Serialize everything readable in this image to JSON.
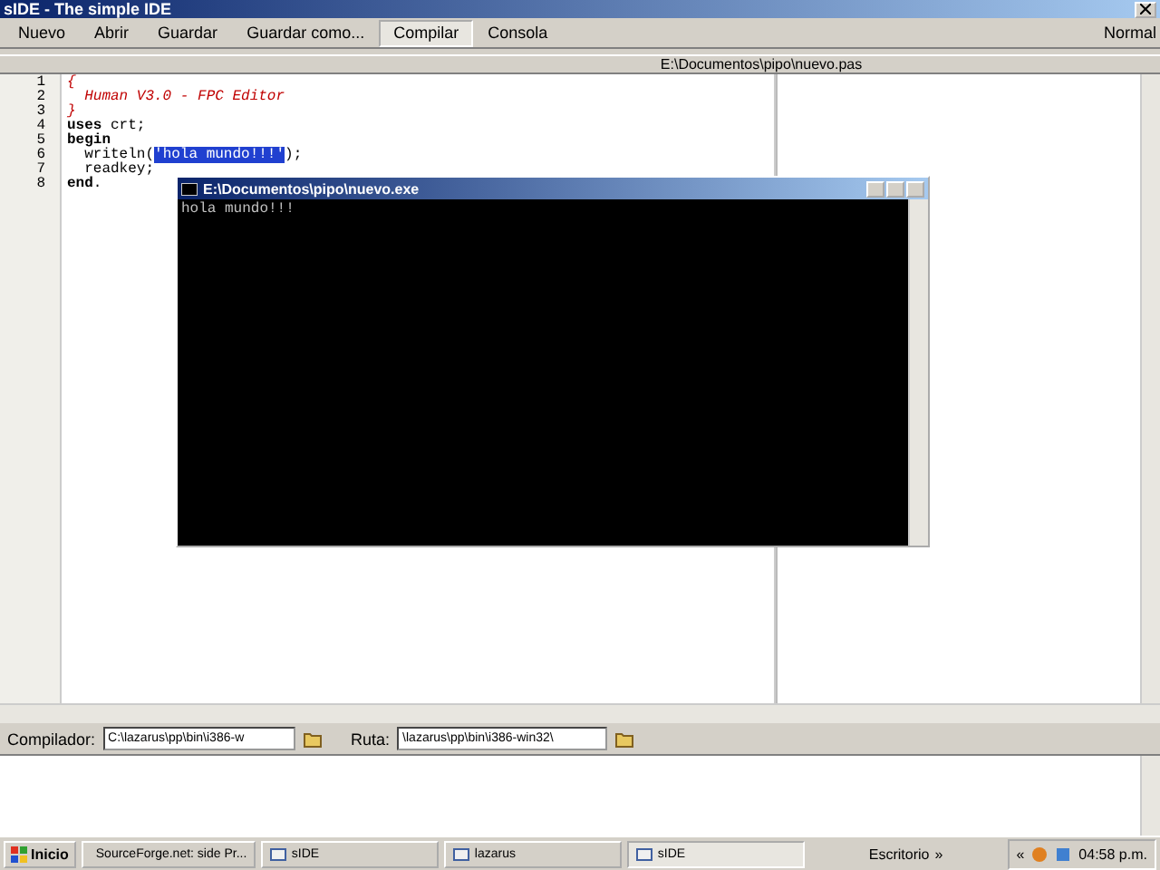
{
  "window": {
    "title": "sIDE - The simple IDE"
  },
  "toolbar": [
    {
      "label": "Nuevo",
      "selected": false
    },
    {
      "label": "Abrir",
      "selected": false
    },
    {
      "label": "Guardar",
      "selected": false
    },
    {
      "label": "Guardar como...",
      "selected": false
    },
    {
      "label": "Compilar",
      "selected": true
    },
    {
      "label": "Consola",
      "selected": false
    }
  ],
  "mode": "Normal",
  "file_path": "E:\\Documentos\\pipo\\nuevo.pas",
  "editor": {
    "lines": [
      {
        "number": "1",
        "segments": [
          {
            "text": "{",
            "kind": "comment"
          }
        ]
      },
      {
        "number": "2",
        "segments": [
          {
            "text": "  Human V3.0 - FPC Editor",
            "kind": "comment"
          }
        ]
      },
      {
        "number": "3",
        "segments": [
          {
            "text": "}",
            "kind": "comment"
          }
        ]
      },
      {
        "number": "4",
        "segments": [
          {
            "text": "uses",
            "kind": "keyword"
          },
          {
            "text": " crt;",
            "kind": "plain"
          }
        ]
      },
      {
        "number": "5",
        "segments": [
          {
            "text": "begin",
            "kind": "keyword"
          }
        ]
      },
      {
        "number": "6",
        "segments": [
          {
            "text": "  writeln(",
            "kind": "plain"
          },
          {
            "text": "'hola mundo!!!'",
            "kind": "selected"
          },
          {
            "text": ");",
            "kind": "plain"
          }
        ]
      },
      {
        "number": "7",
        "segments": [
          {
            "text": "  readkey;",
            "kind": "plain"
          }
        ]
      },
      {
        "number": "8",
        "segments": [
          {
            "text": "end",
            "kind": "keyword"
          },
          {
            "text": ".",
            "kind": "plain"
          }
        ]
      }
    ]
  },
  "console": {
    "title": "E:\\Documentos\\pipo\\nuevo.exe",
    "output": "hola mundo!!!"
  },
  "compiler_bar": {
    "compiler_label": "Compilador:",
    "compiler_value": "C:\\lazarus\\pp\\bin\\i386-w",
    "path_label": "Ruta:",
    "path_value": "\\lazarus\\pp\\bin\\i386-win32\\"
  },
  "taskbar": {
    "start": "Inicio",
    "tasks": [
      {
        "label": "SourceForge.net: side Pr...",
        "selected": false
      },
      {
        "label": "sIDE",
        "selected": false
      },
      {
        "label": "lazarus",
        "selected": false
      },
      {
        "label": "sIDE",
        "selected": true
      }
    ],
    "desktop": "Escritorio",
    "expand": "»",
    "collapse": "«",
    "clock": "04:58 p.m."
  }
}
